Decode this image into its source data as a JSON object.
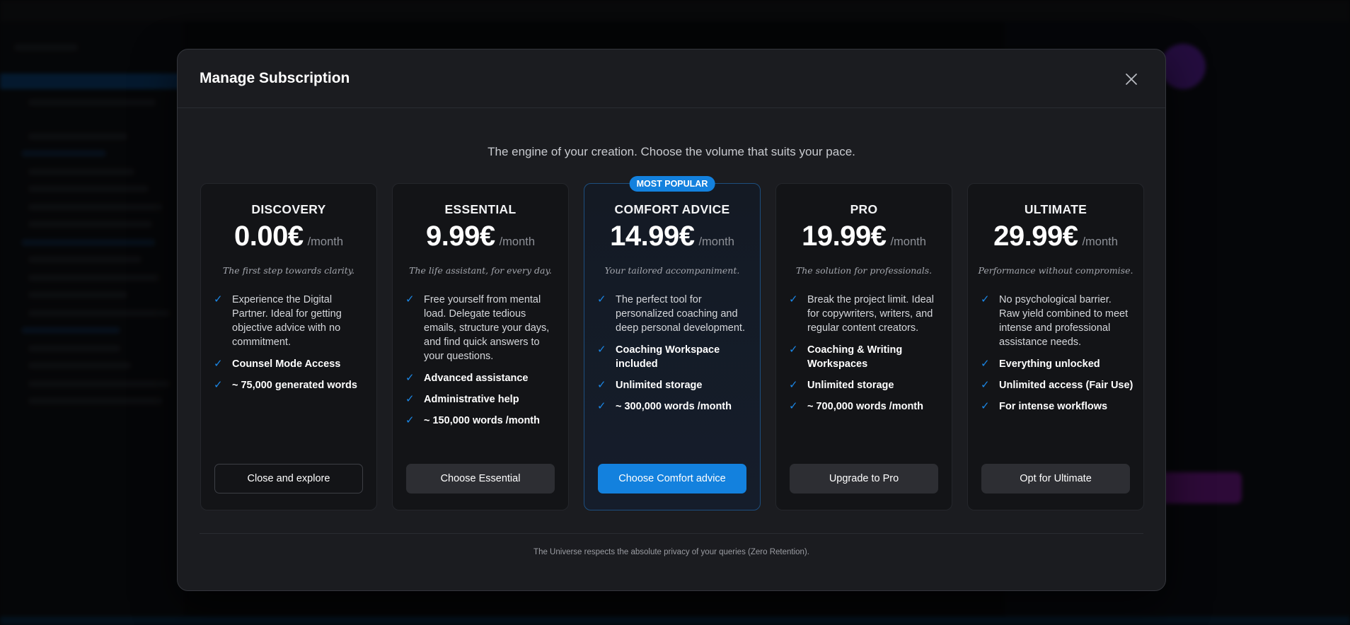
{
  "modal": {
    "title": "Manage Subscription",
    "tagline": "The engine of your creation. Choose the volume that suits your pace.",
    "footer": "The Universe respects the absolute privacy of your queries (Zero Retention).",
    "accent_color": "#1381de"
  },
  "plans": [
    {
      "name": "DISCOVERY",
      "price": "0.00€",
      "period": "/month",
      "subtitle": "The first step towards clarity.",
      "features": [
        "Experience the Digital Partner. Ideal for getting objective advice with no commitment.",
        "Counsel Mode Access",
        "~ 75,000 generated words"
      ],
      "cta": "Close and explore"
    },
    {
      "name": "ESSENTIAL",
      "price": "9.99€",
      "period": "/month",
      "subtitle": "The life assistant, for every day.",
      "features": [
        "Free yourself from mental load. Delegate tedious emails, structure your days, and find quick answers to your questions.",
        "Advanced assistance",
        "Administrative help",
        "~ 150,000 words /month"
      ],
      "cta": "Choose Essential"
    },
    {
      "name": "COMFORT ADVICE",
      "badge": "MOST POPULAR",
      "price": "14.99€",
      "period": "/month",
      "subtitle": "Your tailored accompaniment.",
      "features": [
        "The perfect tool for personalized coaching and deep personal development.",
        "Coaching Workspace included",
        "Unlimited storage",
        "~ 300,000 words /month"
      ],
      "cta": "Choose Comfort advice"
    },
    {
      "name": "PRO",
      "price": "19.99€",
      "period": "/month",
      "subtitle": "The solution for professionals.",
      "features": [
        "Break the project limit. Ideal for copywriters, writers, and regular content creators.",
        "Coaching & Writing Workspaces",
        "Unlimited storage",
        "~ 700,000 words /month"
      ],
      "cta": "Upgrade to Pro"
    },
    {
      "name": "ULTIMATE",
      "price": "29.99€",
      "period": "/month",
      "subtitle": "Performance without compromise.",
      "features": [
        "No psychological barrier. Raw yield combined to meet intense and professional assistance needs.",
        "Everything unlocked",
        "Unlimited access (Fair Use)",
        "For intense workflows"
      ],
      "cta": "Opt for Ultimate"
    }
  ],
  "icons": {
    "close": "close-icon",
    "check": "check-icon"
  }
}
